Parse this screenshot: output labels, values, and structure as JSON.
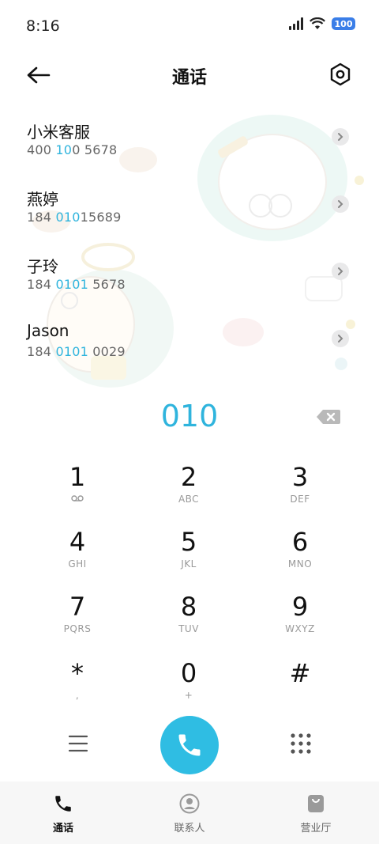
{
  "status_bar": {
    "time": "8:16",
    "battery": "100"
  },
  "header": {
    "title": "通话",
    "back_icon": "back-arrow-icon",
    "settings_icon": "settings-hexagon-icon"
  },
  "results": [
    {
      "name": "小米客服",
      "number_parts": [
        "400",
        " 10",
        "0 5678"
      ],
      "highlight": [
        false,
        true,
        false
      ]
    },
    {
      "name": "燕婷",
      "number_parts": [
        "184 ",
        "010",
        "15689"
      ],
      "highlight": [
        false,
        true,
        false
      ]
    },
    {
      "name": "子玲",
      "number_parts": [
        "184 ",
        "0101",
        " 5678"
      ],
      "highlight": [
        false,
        true,
        false
      ]
    },
    {
      "name": "Jason",
      "number_parts": [
        "184 ",
        "0101",
        " 0029"
      ],
      "highlight": [
        false,
        true,
        false
      ]
    }
  ],
  "dial_input": "010",
  "keys": [
    {
      "digit": "1",
      "letters": ""
    },
    {
      "digit": "2",
      "letters": "ABC"
    },
    {
      "digit": "3",
      "letters": "DEF"
    },
    {
      "digit": "4",
      "letters": "GHI"
    },
    {
      "digit": "5",
      "letters": "JKL"
    },
    {
      "digit": "6",
      "letters": "MNO"
    },
    {
      "digit": "7",
      "letters": "PQRS"
    },
    {
      "digit": "8",
      "letters": "TUV"
    },
    {
      "digit": "9",
      "letters": "WXYZ"
    },
    {
      "digit": "*",
      "letters": ","
    },
    {
      "digit": "0",
      "letters": "+"
    },
    {
      "digit": "#",
      "letters": ""
    }
  ],
  "bottom_nav": [
    {
      "label": "通话",
      "active": true
    },
    {
      "label": "联系人",
      "active": false
    },
    {
      "label": "营业厅",
      "active": false
    }
  ],
  "colors": {
    "accent": "#2fb4dd",
    "call_button": "#2fbde3",
    "battery": "#3a7ee8"
  }
}
